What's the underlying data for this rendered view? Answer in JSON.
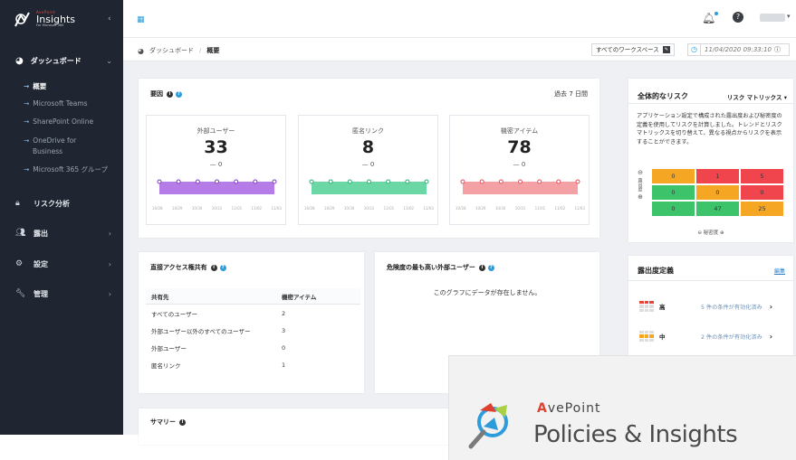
{
  "brand": {
    "vendor": "AvePoint",
    "product": "Insights",
    "subtitle": "For Microsoft 365"
  },
  "sidebar": {
    "dashboard": "ダッシュボード",
    "subitems": [
      "概要",
      "Microsoft Teams",
      "SharePoint Online",
      "OneDrive for",
      "Business",
      "Microsoft 365 グループ"
    ],
    "items": [
      {
        "label": "リスク分析",
        "icon": "lock-icon"
      },
      {
        "label": "露出",
        "icon": "users-icon"
      },
      {
        "label": "設定",
        "icon": "gear-icon"
      },
      {
        "label": "管理",
        "icon": "wrench-icon"
      }
    ]
  },
  "breadcrumb": {
    "root": "ダッシュボード",
    "current": "概要"
  },
  "workspace": {
    "label": "すべてのワークスペース"
  },
  "timestamp": "11/04/2020 09:33:10",
  "factors_card": {
    "title": "要因",
    "period": "過去 7 日間",
    "factors": [
      {
        "label": "外部ユーザー",
        "value": "33",
        "delta": "0",
        "color": "#b57be6"
      },
      {
        "label": "匿名リンク",
        "value": "8",
        "delta": "0",
        "color": "#6ad7a5"
      },
      {
        "label": "機密アイテム",
        "value": "78",
        "delta": "0",
        "color": "#f4a1a6"
      }
    ],
    "ticks": [
      "10/28",
      "10/29",
      "10/30",
      "10/31",
      "11/01",
      "11/02",
      "11/03"
    ]
  },
  "direct_access": {
    "title": "直接アクセス権共有",
    "columns": [
      "共有先",
      "機密アイテム"
    ],
    "rows": [
      [
        "すべてのユーザー",
        "2"
      ],
      [
        "外部ユーザー以外のすべてのユーザー",
        "3"
      ],
      [
        "外部ユーザー",
        "0"
      ],
      [
        "匿名リンク",
        "1"
      ]
    ]
  },
  "risky_users": {
    "title": "危険度の最も高い外部ユーザー",
    "empty": "このグラフにデータが存在しません。"
  },
  "summary": {
    "title": "サマリー"
  },
  "overall_risk": {
    "title": "全体的なリスク",
    "dropdown": "リスク マトリックス",
    "description": "アプリケーション設定で構成された露出度および秘密度の定義を使用してリスクを計算しました。トレンドとリスク マトリックスを切り替えて、異なる視点からリスクを表示することができます。",
    "row_axis": "露出度",
    "col_axis": "秘密度",
    "matrix": [
      [
        {
          "v": "0",
          "c": "#f5a623"
        },
        {
          "v": "1",
          "c": "#f0454d"
        },
        {
          "v": "5",
          "c": "#f0454d"
        }
      ],
      [
        {
          "v": "0",
          "c": "#3dc46b"
        },
        {
          "v": "0",
          "c": "#f5a623"
        },
        {
          "v": "0",
          "c": "#f0454d"
        }
      ],
      [
        {
          "v": "0",
          "c": "#3dc46b"
        },
        {
          "v": "47",
          "c": "#3dc46b"
        },
        {
          "v": "25",
          "c": "#f5a623"
        }
      ]
    ]
  },
  "exposure_def": {
    "title": "露出度定義",
    "edit": "編集",
    "items": [
      {
        "level": "高",
        "status": "5 件の条件が有効化済み",
        "color": "#e8453c"
      },
      {
        "level": "中",
        "status": "2 件の条件が有効化済み",
        "color": "#f5a623"
      }
    ]
  },
  "overlay": {
    "vendor": "AvePoint",
    "product": "Policies & Insights"
  }
}
